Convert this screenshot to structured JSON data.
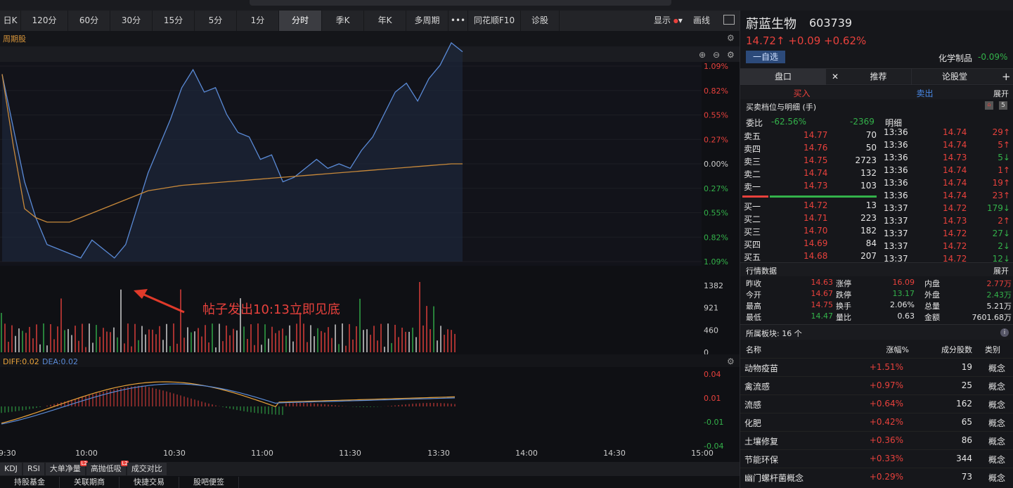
{
  "colors": {
    "accent_red": "#e8413c",
    "accent_green": "#33b24a",
    "price_line": "#5a8ad6",
    "avg_line": "#c8893a"
  },
  "toolbar": {
    "tabs": [
      "日K",
      "120分",
      "60分",
      "30分",
      "15分",
      "5分",
      "1分",
      "分时",
      "季K",
      "年K",
      "多周期",
      "•••",
      "同花顺F10",
      "诊股"
    ],
    "active": "分时",
    "display_label": "显示",
    "draw_label": "画线"
  },
  "chart": {
    "period_label": "周期股",
    "annotation": "帖子发出10:13立即见底",
    "pct_ticks_right": [
      "1.09%",
      "0.82%",
      "0.55%",
      "0.27%",
      "0.00%",
      "0.27%",
      "0.55%",
      "0.82%",
      "1.09%"
    ],
    "volume_ticks": [
      "1382",
      "921",
      "460",
      "0"
    ],
    "macd_label_diff": "DIFF:0.02",
    "macd_label_dea": "DEA:0.02",
    "macd_ticks": [
      "0.04",
      "0.01",
      "-0.01",
      "-0.04"
    ],
    "time_ticks": [
      "9:30",
      "10:00",
      "10:30",
      "11:00",
      "11:30",
      "13:30",
      "14:00",
      "14:30",
      "15:00"
    ]
  },
  "chart_data": {
    "type": "line",
    "title": "",
    "series": [
      {
        "values": [
          1.0,
          0.4,
          -0.2,
          -0.6,
          -0.9,
          -0.95,
          -1.0,
          -1.05,
          -0.85,
          -0.95,
          -1.05,
          -0.9,
          -0.5,
          -0.1,
          0.2,
          0.5,
          0.85,
          1.05,
          0.8,
          0.85,
          0.55,
          0.35,
          0.3,
          0.05,
          0.1,
          -0.2,
          -0.15,
          -0.05,
          0.05,
          -0.05,
          0.0,
          -0.05,
          0.15,
          0.3,
          0.55,
          0.8,
          0.9,
          0.7,
          0.95,
          1.1,
          1.35,
          1.25
        ]
      },
      {
        "values": [
          1.0,
          0.2,
          -0.5,
          -0.6,
          -0.65,
          -0.65,
          -0.65,
          -0.6,
          -0.55,
          -0.5,
          -0.45,
          -0.4,
          -0.35,
          -0.3,
          -0.28,
          -0.26,
          -0.24,
          -0.23,
          -0.22,
          -0.21,
          -0.2,
          -0.19,
          -0.18,
          -0.17,
          -0.16,
          -0.15,
          -0.14,
          -0.13,
          -0.12,
          -0.11,
          -0.1,
          -0.09,
          -0.08,
          -0.07,
          -0.06,
          -0.05,
          -0.04,
          -0.03,
          -0.02,
          -0.01,
          0.0,
          0.0
        ]
      }
    ],
    "ylim": [
      -1.09,
      1.09
    ]
  },
  "stock": {
    "name": "蔚蓝生物",
    "code": "603739",
    "price": "14.72↑",
    "change": "+0.09",
    "change_pct": "+0.62%",
    "watch_btn": "一自选",
    "sector": "化学制品",
    "sector_pct": "-0.09%"
  },
  "panel_tabs": [
    "盘口",
    "推荐",
    "论股堂"
  ],
  "buysell_tabs": [
    "买入",
    "卖出",
    "展开"
  ],
  "orderbook": {
    "title": "买卖档位与明细 (手)",
    "ratio_label": "委比",
    "ratio": "-62.56%",
    "diff": "-2369",
    "detail_label": "明细",
    "asks": [
      [
        "卖五",
        "14.77",
        "70"
      ],
      [
        "卖四",
        "14.76",
        "50"
      ],
      [
        "卖三",
        "14.75",
        "2723"
      ],
      [
        "卖二",
        "14.74",
        "132"
      ],
      [
        "卖一",
        "14.73",
        "103"
      ]
    ],
    "bids": [
      [
        "买一",
        "14.72",
        "13"
      ],
      [
        "买二",
        "14.71",
        "223"
      ],
      [
        "买三",
        "14.70",
        "182"
      ],
      [
        "买四",
        "14.69",
        "84"
      ],
      [
        "买五",
        "14.68",
        "207"
      ]
    ],
    "ticks": [
      [
        "13:36",
        "14.74",
        "29↑"
      ],
      [
        "13:36",
        "14.74",
        "5↑"
      ],
      [
        "13:36",
        "14.73",
        "5↓"
      ],
      [
        "13:36",
        "14.74",
        "1↑"
      ],
      [
        "13:36",
        "14.74",
        "19↑"
      ],
      [
        "13:36",
        "14.74",
        "23↑"
      ],
      [
        "13:37",
        "14.72",
        "179↓"
      ],
      [
        "13:37",
        "14.73",
        "2↑"
      ],
      [
        "13:37",
        "14.72",
        "27↓"
      ],
      [
        "13:37",
        "14.72",
        "2↓"
      ],
      [
        "13:37",
        "14.72",
        "12↓"
      ]
    ]
  },
  "quote": {
    "title": "行情数据",
    "expand": "展开",
    "rows": [
      [
        "昨收",
        "14.63",
        "涨停",
        "16.09",
        "内盘",
        "2.77万"
      ],
      [
        "今开",
        "14.67",
        "跌停",
        "13.17",
        "外盘",
        "2.43万"
      ],
      [
        "最高",
        "14.75",
        "换手",
        "2.06%",
        "总量",
        "5.21万"
      ],
      [
        "最低",
        "14.47",
        "量比",
        "0.63",
        "金额",
        "7601.68万"
      ]
    ]
  },
  "sectors": {
    "title": "所属板块: 16 个",
    "cols": [
      "名称",
      "涨幅%",
      "成分股数",
      "类别"
    ],
    "rows": [
      [
        "动物疫苗",
        "+1.51%",
        "19",
        "概念"
      ],
      [
        "禽流感",
        "+0.97%",
        "25",
        "概念"
      ],
      [
        "流感",
        "+0.64%",
        "162",
        "概念"
      ],
      [
        "化肥",
        "+0.42%",
        "65",
        "概念"
      ],
      [
        "土壤修复",
        "+0.36%",
        "86",
        "概念"
      ],
      [
        "节能环保",
        "+0.33%",
        "344",
        "概念"
      ],
      [
        "幽门螺杆菌概念",
        "+0.29%",
        "73",
        "概念"
      ]
    ]
  },
  "bottom": {
    "tabs1": [
      "KDJ",
      "RSI",
      "大单净量",
      "高抛低吸",
      "成交对比"
    ],
    "tabs2": [
      "持股基金",
      "关联期商",
      "快捷交易",
      "股吧便签"
    ]
  }
}
